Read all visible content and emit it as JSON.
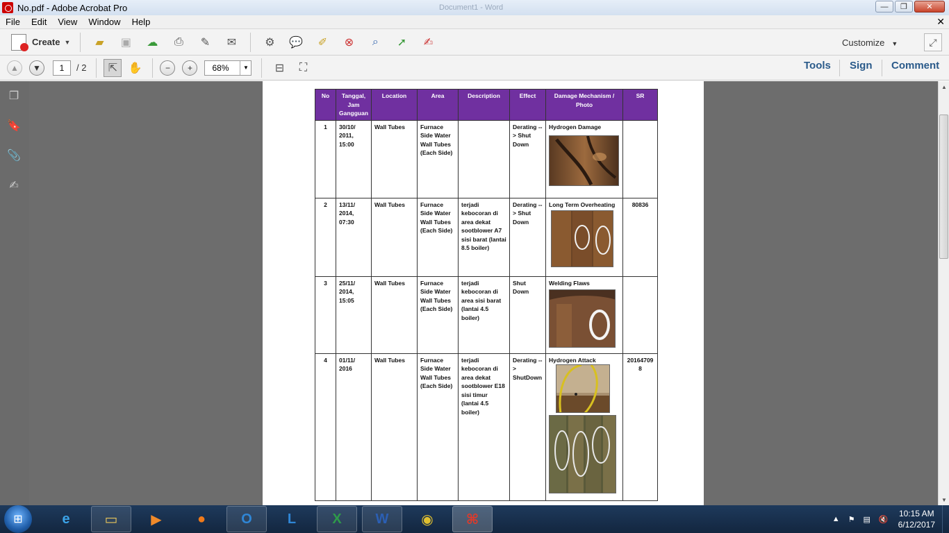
{
  "window": {
    "title": "No.pdf - Adobe Acrobat Pro",
    "ghost_title": "Document1 - Word",
    "minimize": "—",
    "maximize": "❐",
    "close": "✕"
  },
  "menubar": {
    "items": [
      "File",
      "Edit",
      "View",
      "Window",
      "Help"
    ],
    "doc_close": "✕"
  },
  "toolbar": {
    "create_label": "Create",
    "customize_label": "Customize"
  },
  "nav": {
    "current_page": "1",
    "page_count": "/ 2",
    "zoom": "68%"
  },
  "panels": {
    "tools": "Tools",
    "sign": "Sign",
    "comment": "Comment"
  },
  "table": {
    "headers": [
      "No",
      "Tanggal, Jam Gangguan",
      "Location",
      "Area",
      "Description",
      "Effect",
      "Damage Mechanism / Photo",
      "SR"
    ],
    "rows": [
      {
        "no": "1",
        "date": "30/10/ 2011, 15:00",
        "location": "Wall Tubes",
        "area": "Furnace Side Water Wall Tubes (Each Side)",
        "description": "",
        "effect": "Derating --> Shut Down",
        "mechanism": "Hydrogen Damage",
        "sr": ""
      },
      {
        "no": "2",
        "date": "13/11/ 2014, 07:30",
        "location": "Wall Tubes",
        "area": "Furnace Side Water Wall Tubes (Each Side)",
        "description": "terjadi kebocoran di area dekat sootblower A7 sisi barat (lantai 8.5 boiler)",
        "effect": "Derating --> Shut Down",
        "mechanism": "Long Term Overheating",
        "sr": "80836"
      },
      {
        "no": "3",
        "date": "25/11/ 2014, 15:05",
        "location": "Wall Tubes",
        "area": "Furnace Side Water Wall Tubes (Each Side)",
        "description": "terjadi kebocoran di area sisi barat (lantai 4.5 boiler)",
        "effect": "Shut Down",
        "mechanism": "Welding Flaws",
        "sr": ""
      },
      {
        "no": "4",
        "date": "01/11/ 2016",
        "location": "Wall Tubes",
        "area": "Furnace Side Water Wall Tubes (Each Side)",
        "description": "terjadi kebocoran di area dekat sootblower E18 sisi timur (lantai 4.5 boiler)",
        "effect": "Derating --> ShutDown",
        "mechanism": "Hydrogen Attack",
        "sr": "201647098"
      }
    ]
  },
  "taskbar": {
    "time": "10:15 AM",
    "date": "6/12/2017"
  },
  "colors": {
    "header_purple": "#7030a0",
    "panel_link": "#2a5a8a"
  }
}
